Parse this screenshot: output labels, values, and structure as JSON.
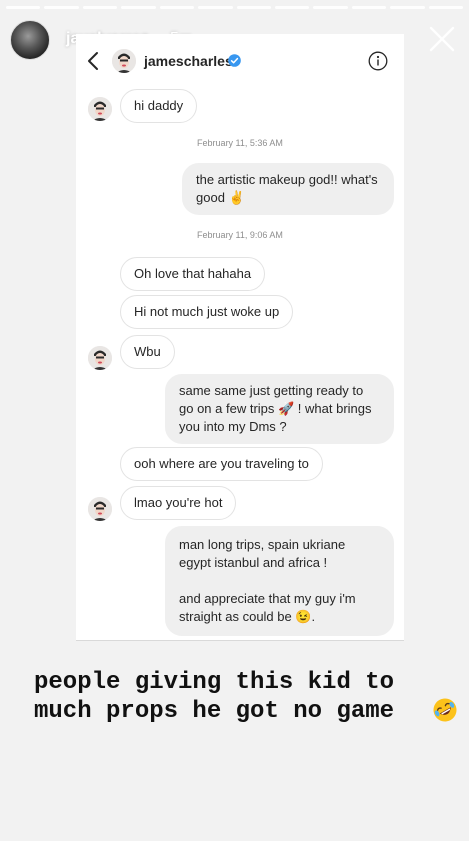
{
  "story": {
    "username": "jayalvarrez",
    "time_ago": "5m",
    "caption": "people giving this kid to much props he got no game",
    "caption_emoji_icon": "rolling-on-floor-laughing-emoji-icon",
    "progress_segments": 12
  },
  "dm": {
    "contact": "jamescharles",
    "verified": true,
    "messages": [
      {
        "dir": "in",
        "text": "hi daddy"
      },
      {
        "type": "timestamp",
        "text": "February 11, 5:36 AM"
      },
      {
        "dir": "out",
        "text": "the artistic makeup god!! what's good ✌"
      },
      {
        "type": "timestamp",
        "text": "February 11, 9:06 AM"
      },
      {
        "dir": "in",
        "text": "Oh love that hahaha"
      },
      {
        "dir": "in",
        "text": "Hi not much just woke up"
      },
      {
        "dir": "in",
        "text": "Wbu"
      },
      {
        "dir": "out",
        "text": "same same just getting ready to go on a few trips 🚀 ! what brings you into my Dms ?"
      },
      {
        "dir": "in",
        "text": "ooh where are you traveling to"
      },
      {
        "dir": "in",
        "text": "lmao you're hot"
      },
      {
        "dir": "out",
        "text": "man long trips, spain ukriane egypt istanbul and africa !"
      },
      {
        "dir": "out",
        "text": "and appreciate that my guy i'm straight as could be 😉."
      }
    ]
  },
  "colors": {
    "verified_blue": "#3897f0",
    "bubble_out": "#efefef",
    "bubble_in_border": "#e3e3e3",
    "timestamp": "#8e8e8e"
  }
}
